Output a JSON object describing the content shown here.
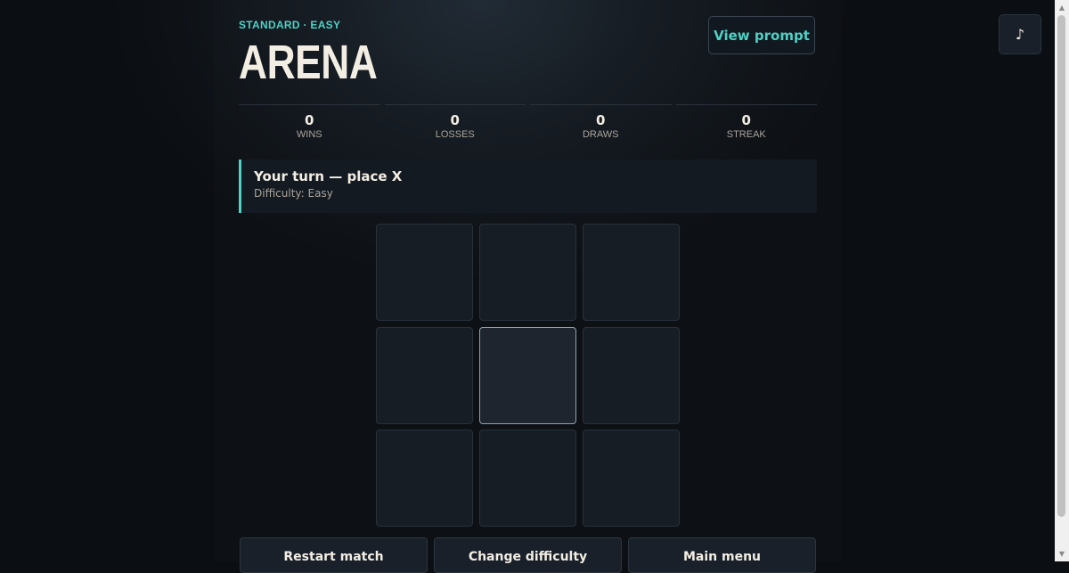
{
  "header": {
    "mode_label": "STANDARD · EASY",
    "title": "ARENA",
    "view_prompt_label": "View prompt",
    "music_icon": "♪"
  },
  "stats": [
    {
      "value": "0",
      "label": "WINS"
    },
    {
      "value": "0",
      "label": "LOSSES"
    },
    {
      "value": "0",
      "label": "DRAWS"
    },
    {
      "value": "0",
      "label": "STREAK"
    }
  ],
  "status": {
    "title": "Your turn — place X",
    "subtitle": "Difficulty: Easy"
  },
  "board": {
    "cells": [
      "",
      "",
      "",
      "",
      "",
      "",
      "",
      "",
      ""
    ],
    "hovered_cell": 4
  },
  "actions": {
    "restart_label": "Restart match",
    "change_difficulty_label": "Change difficulty",
    "main_menu_label": "Main menu"
  },
  "colors": {
    "accent": "#4fd1c5",
    "background": "#0b0e12",
    "cell": "#161d25",
    "title": "#f3eee4"
  }
}
